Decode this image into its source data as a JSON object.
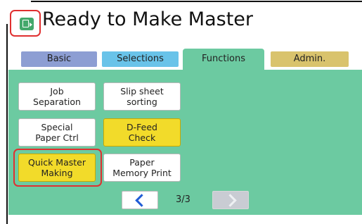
{
  "header": {
    "title": "Ready to Make Master",
    "app_icon": "master-icon"
  },
  "tabs": [
    {
      "label": "Basic",
      "active": false,
      "color": "#8d9ed3"
    },
    {
      "label": "Selections",
      "active": false,
      "color": "#69c3e9"
    },
    {
      "label": "Functions",
      "active": true,
      "color": "#6ccaa1"
    },
    {
      "label": "Admin.",
      "active": false,
      "color": "#d9c36d"
    }
  ],
  "functions": {
    "job_separation": {
      "line1": "Job",
      "line2": "Separation"
    },
    "slip_sheet_sorting": {
      "line1": "Slip sheet",
      "line2": "sorting"
    },
    "special_paper_ctrl": {
      "line1": "Special",
      "line2": "Paper Ctrl"
    },
    "d_feed_check": {
      "line1": "D-Feed",
      "line2": "Check",
      "active": true
    },
    "quick_master_making": {
      "line1": "Quick Master",
      "line2": "Making",
      "active": true,
      "highlighted": true
    },
    "paper_memory_print": {
      "line1": "Paper",
      "line2": "Memory Print"
    }
  },
  "pagination": {
    "indicator": "3/3",
    "prev_enabled": true,
    "next_enabled": false
  },
  "colors": {
    "panel": "#6ccaa1",
    "active_button": "#f2db2a",
    "highlight": "#e03030",
    "accent": "#1f5bd6"
  }
}
